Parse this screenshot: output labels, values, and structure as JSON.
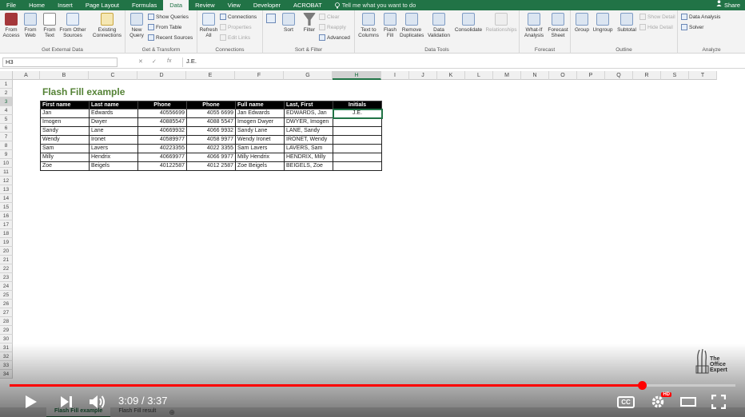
{
  "ribbon_tabs": [
    {
      "label": "File"
    },
    {
      "label": "Home"
    },
    {
      "label": "Insert"
    },
    {
      "label": "Page Layout"
    },
    {
      "label": "Formulas"
    },
    {
      "label": "Data",
      "active": true
    },
    {
      "label": "Review"
    },
    {
      "label": "View"
    },
    {
      "label": "Developer"
    },
    {
      "label": "ACROBAT"
    }
  ],
  "tell_me": "Tell me what you want to do",
  "share_label": "Share",
  "ribbon": {
    "get_external": {
      "label": "Get External Data",
      "from_access": "From Access",
      "from_web": "From Web",
      "from_text": "From Text",
      "from_other": "From Other Sources",
      "existing": "Existing Connections"
    },
    "get_transform": {
      "label": "Get & Transform",
      "new_query": "New Query",
      "show_queries": "Show Queries",
      "from_table": "From Table",
      "recent_sources": "Recent Sources"
    },
    "connections": {
      "label": "Connections",
      "refresh_all": "Refresh All",
      "connections": "Connections",
      "properties": "Properties",
      "edit_links": "Edit Links"
    },
    "sort_filter": {
      "label": "Sort & Filter",
      "sort": "Sort",
      "filter": "Filter",
      "clear": "Clear",
      "reapply": "Reapply",
      "advanced": "Advanced"
    },
    "data_tools": {
      "label": "Data Tools",
      "text_to_columns": "Text to Columns",
      "flash_fill": "Flash Fill",
      "remove_duplicates": "Remove Duplicates",
      "data_validation": "Data Validation",
      "consolidate": "Consolidate",
      "relationships": "Relationships"
    },
    "forecast": {
      "label": "Forecast",
      "what_if": "What-If Analysis",
      "forecast_sheet": "Forecast Sheet"
    },
    "outline": {
      "label": "Outline",
      "group": "Group",
      "ungroup": "Ungroup",
      "subtotal": "Subtotal",
      "show_detail": "Show Detail",
      "hide_detail": "Hide Detail"
    },
    "analyze": {
      "label": "Analyze",
      "data_analysis": "Data Analysis",
      "solver": "Solver"
    }
  },
  "formula_bar": {
    "name_box": "H3",
    "formula": "J.E."
  },
  "columns": [
    "A",
    "B",
    "C",
    "D",
    "E",
    "F",
    "G",
    "H",
    "I",
    "J",
    "K",
    "L",
    "M",
    "N",
    "O",
    "P",
    "Q",
    "R",
    "S",
    "T"
  ],
  "selected_column": "H",
  "rows": [
    "1",
    "2",
    "3",
    "4",
    "5",
    "6",
    "7",
    "8",
    "9",
    "10",
    "11",
    "12",
    "13",
    "14",
    "15",
    "16",
    "17",
    "18",
    "19",
    "20",
    "21",
    "22",
    "23",
    "24",
    "25",
    "26",
    "27",
    "28",
    "29",
    "30",
    "31",
    "32",
    "33",
    "34"
  ],
  "selected_row": "3",
  "sheet_title": "Flash Fill example",
  "table": {
    "headers": [
      "First name",
      "Last name",
      "Phone",
      "Phone",
      "Full name",
      "Last, First",
      "Initials"
    ],
    "rows": [
      [
        "Jan",
        "Edwards",
        "40556699",
        "4055 6699",
        "Jan Edwards",
        "EDWARDS, Jan",
        "J.E."
      ],
      [
        "Imogen",
        "Dwyer",
        "40885547",
        "4088 5547",
        "Imogen Dwyer",
        "DWYER, Imogen",
        ""
      ],
      [
        "Sandy",
        "Lane",
        "40669932",
        "4066 9932",
        "Sandy Lane",
        "LANE, Sandy",
        ""
      ],
      [
        "Wendy",
        "Ironet",
        "40589977",
        "4058 9977",
        "Wendy Ironet",
        "IRONET, Wendy",
        ""
      ],
      [
        "Sam",
        "Lavers",
        "40223355",
        "4022 3355",
        "Sam Lavers",
        "LAVERS, Sam",
        ""
      ],
      [
        "Milly",
        "Hendrix",
        "40669977",
        "4066 9977",
        "Milly Hendrix",
        "HENDRIX, Milly",
        ""
      ],
      [
        "Zoe",
        "Beigels",
        "40122587",
        "4012 2587",
        "Zoe Beigels",
        "BEIGELS, Zoe",
        ""
      ]
    ]
  },
  "sheet_tabs": [
    {
      "label": "Flash Fill example",
      "active": true
    },
    {
      "label": "Flash Fill result"
    }
  ],
  "logo": {
    "line1": "The",
    "line2": "Office",
    "line3": "Expert"
  },
  "video": {
    "current_time": "3:09",
    "separator": "/",
    "duration": "3:37",
    "progress_fraction": 0.871,
    "hd_badge": "HD",
    "cc_label": "CC",
    "accent": "#ff0000"
  },
  "colors": {
    "excel_green": "#217346",
    "title_green": "#548235"
  }
}
